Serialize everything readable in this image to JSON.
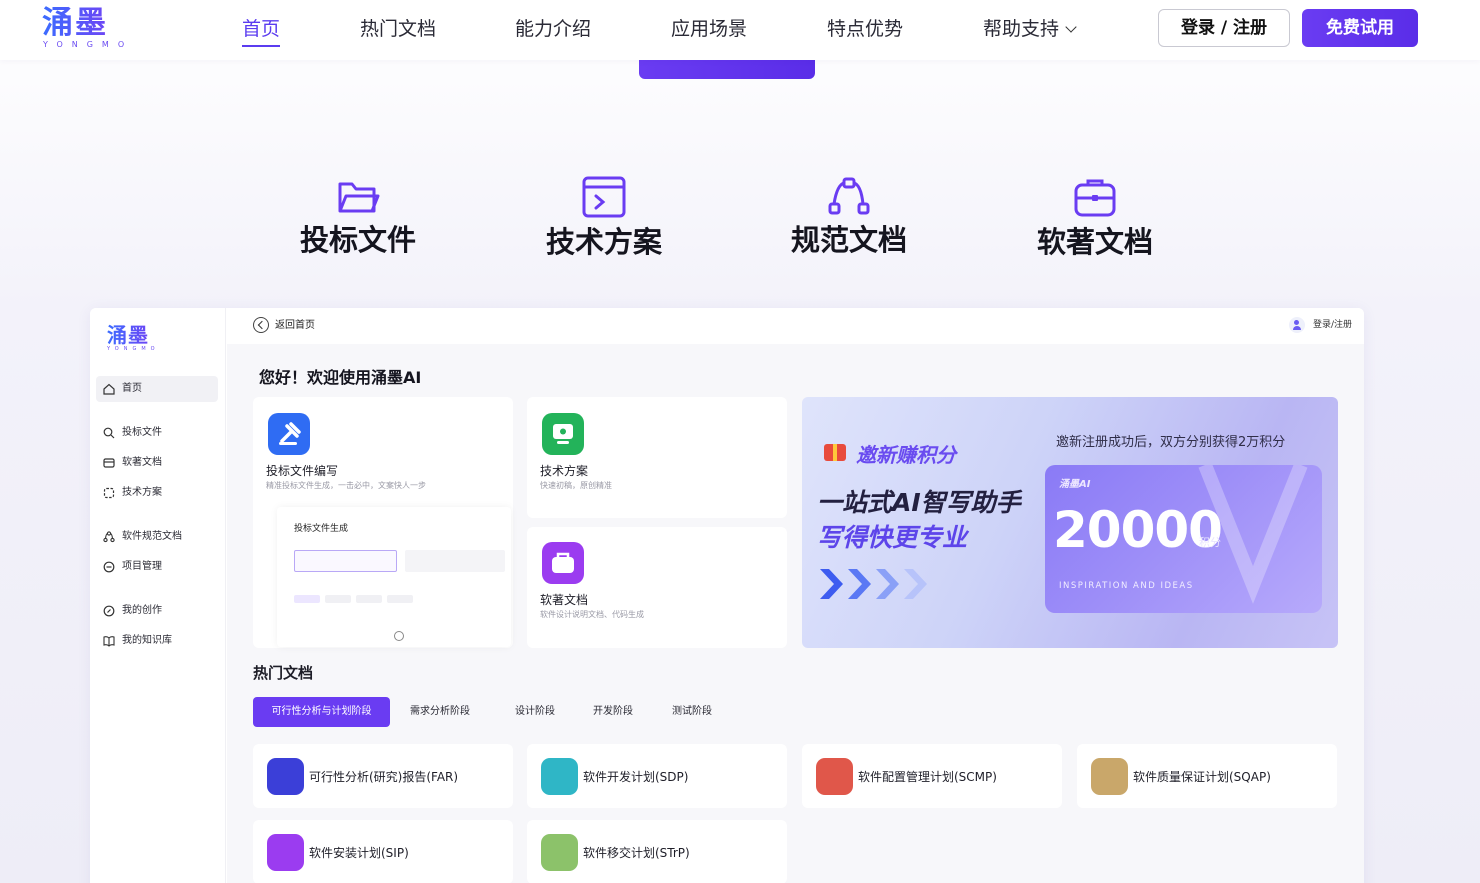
{
  "brand": {
    "name": "涌墨",
    "sub": "YONGMO"
  },
  "nav": {
    "items": [
      "首页",
      "热门文档",
      "能力介绍",
      "应用场景",
      "特点优势",
      "帮助支持"
    ],
    "login": "登录 / 注册",
    "trial": "免费试用"
  },
  "categories": [
    "投标文件",
    "技术方案",
    "规范文档",
    "软著文档"
  ],
  "app": {
    "back": "返回首页",
    "user_login": "登录/注册",
    "welcome": "您好！欢迎使用涌墨AI",
    "sidebar": [
      "首页",
      "投标文件",
      "软著文档",
      "技术方案",
      "软件规范文档",
      "项目管理",
      "我的创作",
      "我的知识库"
    ],
    "cards": [
      {
        "title": "投标文件编写",
        "desc": "精准投标文件生成，一击必中，文案快人一步"
      },
      {
        "title": "技术方案",
        "desc": "快速初稿，原创精准"
      },
      {
        "title": "软著文档",
        "desc": "软件设计说明文档、代码生成"
      }
    ],
    "mini_title": "投标文件生成",
    "banner": {
      "invite": "邀新赚积分",
      "note": "邀新注册成功后，双方分别获得2万积分",
      "headline1": "一站式AI智写助手",
      "headline2": "写得快更专业",
      "ticket_tag": "涌墨AI",
      "points": "20000",
      "unit": "积分",
      "tagline": "INSPIRATION AND IDEAS"
    },
    "hot_title": "热门文档",
    "tabs": [
      "可行性分析与计划阶段",
      "需求分析阶段",
      "设计阶段",
      "开发阶段",
      "测试阶段"
    ],
    "docs": [
      {
        "title": "可行性分析(研究)报告(FAR)",
        "color": "#3b3fd8"
      },
      {
        "title": "软件开发计划(SDP)",
        "color": "#2fb6c6"
      },
      {
        "title": "软件配置管理计划(SCMP)",
        "color": "#e0574a"
      },
      {
        "title": "软件质量保证计划(SQAP)",
        "color": "#c9a76a"
      },
      {
        "title": "软件安装计划(SIP)",
        "color": "#9b3cf0"
      },
      {
        "title": "软件移交计划(STrP)",
        "color": "#8cc26a"
      }
    ]
  },
  "colors": {
    "accent": "#6a3cf2",
    "accent_dark": "#5a2de8"
  }
}
